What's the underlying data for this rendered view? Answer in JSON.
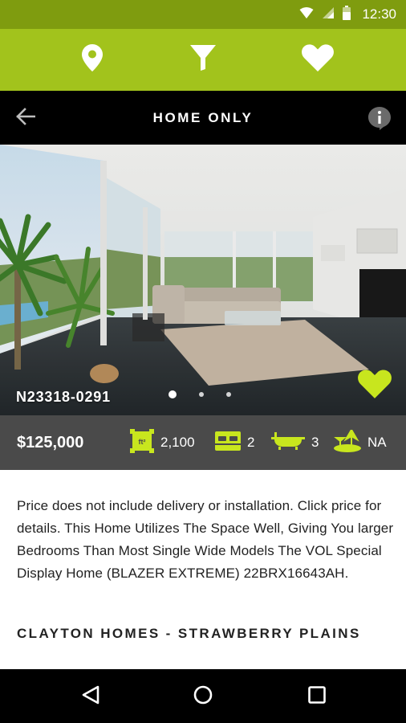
{
  "status_bar": {
    "time": "12:30",
    "icons": [
      "wifi-icon",
      "signal-icon",
      "battery-icon"
    ]
  },
  "tabs": [
    {
      "name": "location",
      "icon": "map-pin-icon"
    },
    {
      "name": "filter",
      "icon": "filter-icon"
    },
    {
      "name": "favorites",
      "icon": "heart-icon"
    }
  ],
  "header": {
    "title": "HOME ONLY"
  },
  "listing": {
    "id": "N23318-0291",
    "photo_count": 3,
    "active_photo": 1,
    "price": "$125,000",
    "sqft": "2,100",
    "sqft_icon_label": "ft²",
    "bedrooms": "2",
    "bathrooms": "3",
    "land": "NA",
    "description": "Price does not include delivery or installation. Click price for details. This Home Utilizes The Space Well, Giving You larger Bedrooms Than Most Single Wide Models The VOL Special Display Home (BLAZER EXTREME) 22BRX16643AH.",
    "dealer": "CLAYTON HOMES - STRAWBERRY PLAINS"
  },
  "colors": {
    "brand_green": "#a2c31c",
    "status_green": "#7f9c0f",
    "accent_lime": "#c8e61e",
    "stats_bg": "#4a4a4a"
  }
}
